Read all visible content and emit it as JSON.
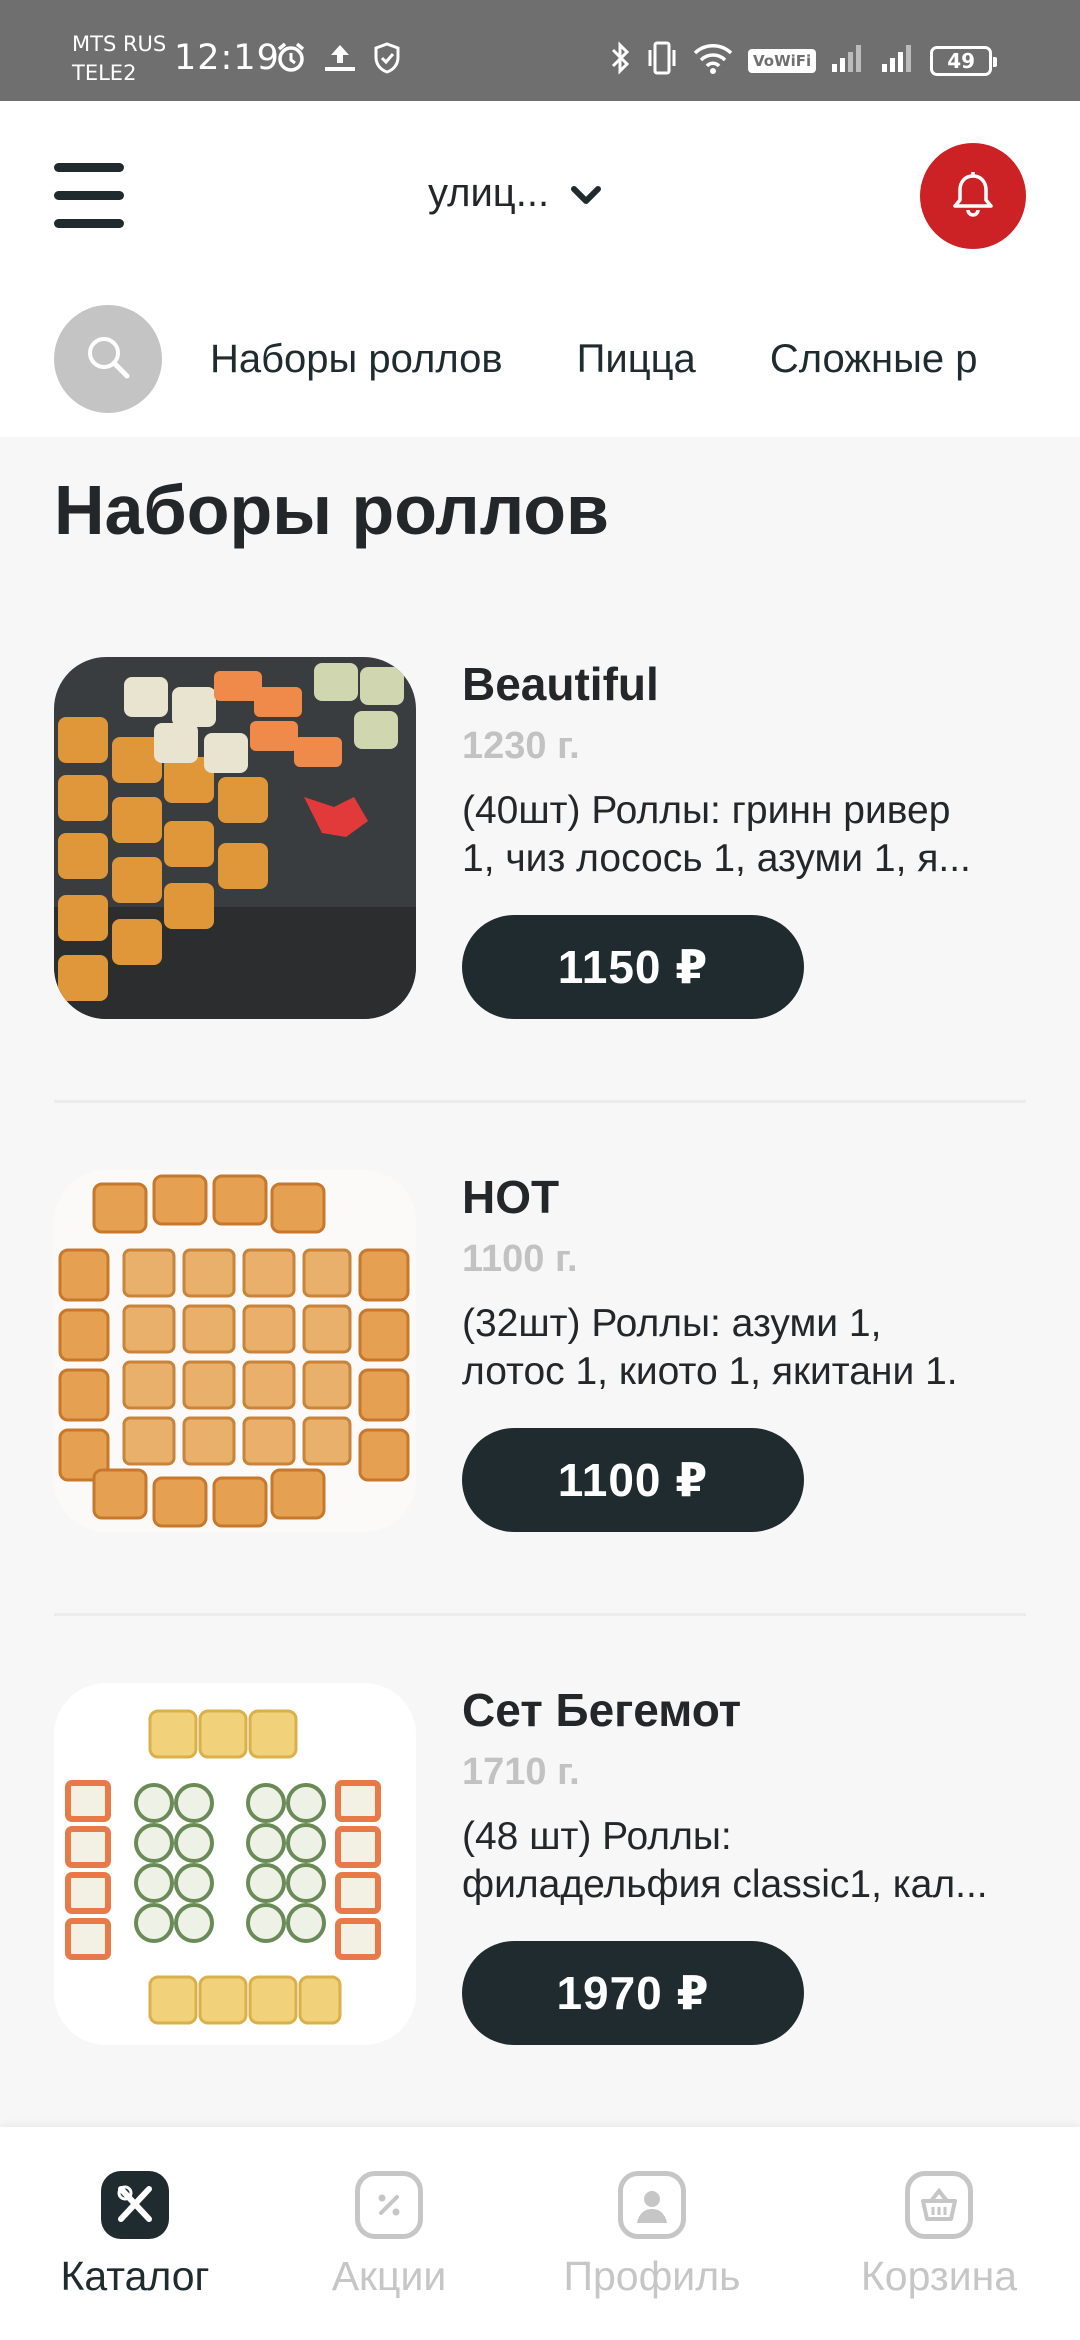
{
  "status_bar": {
    "carrier_1": "MTS RUS",
    "carrier_2": "TELE2",
    "time": "12:19",
    "vowifi_label": "VoWiFi",
    "battery": "49",
    "icons": [
      "alarm-icon",
      "upload-icon",
      "shield-icon",
      "bluetooth-icon",
      "vibrate-icon",
      "wifi-icon",
      "signal-icon",
      "signal-icon",
      "battery-icon"
    ]
  },
  "header": {
    "address": "улиц...",
    "icons": {
      "menu": "hamburger-icon",
      "address_dropdown": "chevron-down-icon",
      "notifications": "bell-icon",
      "search": "search-icon"
    },
    "colors": {
      "bell_button": "#cc2226",
      "search_button": "#c4c4c4"
    }
  },
  "categories": [
    {
      "label": "Наборы роллов"
    },
    {
      "label": "Пицца"
    },
    {
      "label": "Сложные р"
    }
  ],
  "section": {
    "title": "Наборы роллов"
  },
  "products": [
    {
      "name": "Beautiful",
      "weight": "1230 г.",
      "description": "(40шт) Роллы: гринн ривер\n1, чиз лосось 1, азуми 1, я...",
      "price": "1150 ₽"
    },
    {
      "name": "HOT",
      "weight": "1100 г.",
      "description": "(32шт) Роллы: азуми 1,\nлотос 1, киото 1, якитани 1.",
      "price": "1100 ₽"
    },
    {
      "name": "Сет Бегемот",
      "weight": "1710 г.",
      "description": "(48 шт) Роллы:\nфиладельфия classic1, кал...",
      "price": "1970 ₽"
    }
  ],
  "bottom_nav": [
    {
      "label": "Каталог",
      "icon": "catalog-icon",
      "active": true
    },
    {
      "label": "Акции",
      "icon": "discount-icon",
      "active": false
    },
    {
      "label": "Профиль",
      "icon": "profile-icon",
      "active": false
    },
    {
      "label": "Корзина",
      "icon": "basket-icon",
      "active": false
    }
  ],
  "colors": {
    "accent_dark": "#1f2b2e",
    "nav_inactive": "#c6c6c6",
    "weight_text": "#c2c2c2"
  }
}
